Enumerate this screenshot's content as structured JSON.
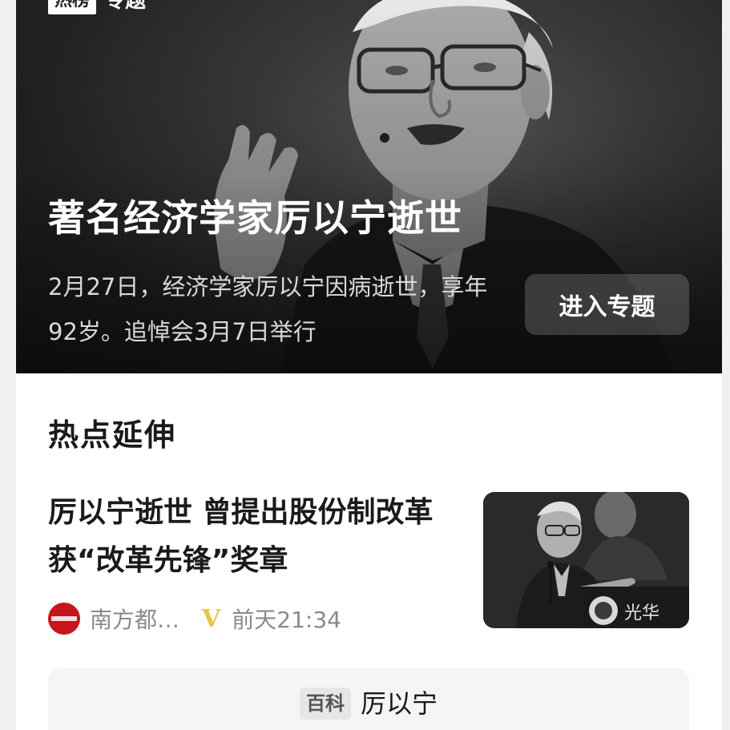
{
  "hero": {
    "tag": "热榜",
    "label": "专题",
    "title": "著名经济学家厉以宁逝世",
    "description": "2月27日，经济学家厉以宁因病逝世，享年92岁。追悼会3月7日举行",
    "enter_button": "进入专题"
  },
  "section": {
    "title": "热点延伸"
  },
  "article": {
    "title": "厉以宁逝世 曾提出股份制改革获“改革先锋”奖章",
    "source": "南方都…",
    "verified_badge": "V",
    "time": "前天21:34",
    "thumb_caption": "光华"
  },
  "baike": {
    "tag": "百科",
    "name": "厉以宁"
  },
  "colors": {
    "source_logo": "#c8151d",
    "verified": "#e6c34a"
  }
}
